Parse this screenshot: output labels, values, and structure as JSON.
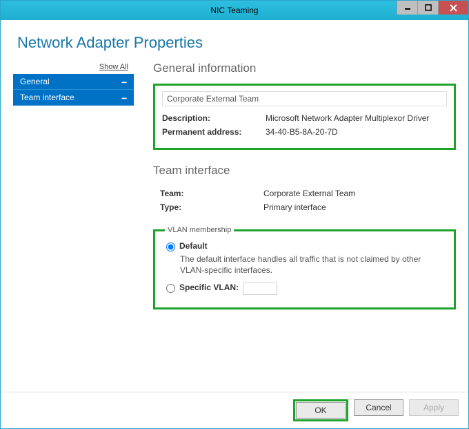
{
  "window": {
    "title": "NIC Teaming"
  },
  "page": {
    "title": "Network Adapter Properties"
  },
  "sidebar": {
    "show_all": "Show All",
    "items": [
      {
        "label": "General"
      },
      {
        "label": "Team interface"
      }
    ]
  },
  "sections": {
    "general": {
      "title": "General information",
      "team_name": "Corporate External Team",
      "rows": [
        {
          "label": "Description:",
          "value": "Microsoft Network Adapter Multiplexor Driver"
        },
        {
          "label": "Permanent address:",
          "value": "34-40-B5-8A-20-7D"
        }
      ]
    },
    "team_interface": {
      "title": "Team interface",
      "rows": [
        {
          "label": "Team:",
          "value": "Corporate External Team"
        },
        {
          "label": "Type:",
          "value": "Primary interface"
        }
      ],
      "vlan": {
        "legend": "VLAN membership",
        "default_label": "Default",
        "default_desc": "The default interface handles all traffic that is not claimed by other VLAN-specific interfaces.",
        "specific_label": "Specific VLAN:",
        "selected": "default"
      }
    }
  },
  "footer": {
    "ok": "OK",
    "cancel": "Cancel",
    "apply": "Apply"
  }
}
